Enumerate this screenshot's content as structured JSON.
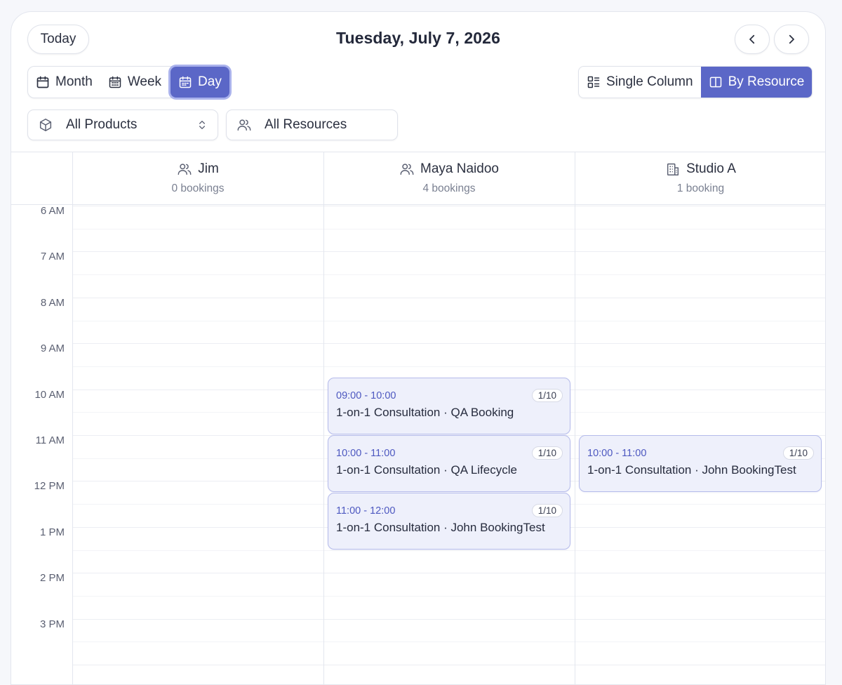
{
  "header": {
    "today_label": "Today",
    "date_title": "Tuesday, July 7, 2026",
    "prev_icon": "chevron-left-icon",
    "next_icon": "chevron-right-icon"
  },
  "views": {
    "month": "Month",
    "week": "Week",
    "day": "Day",
    "active": "Day"
  },
  "layout": {
    "single_column": "Single Column",
    "by_resource": "By Resource",
    "active": "By Resource"
  },
  "filters": {
    "products": "All Products",
    "resources": "All Resources"
  },
  "resources": [
    {
      "name": "Jim",
      "count": "0 bookings",
      "icon": "users-icon"
    },
    {
      "name": "Maya Naidoo",
      "count": "4 bookings",
      "icon": "users-icon"
    },
    {
      "name": "Studio A",
      "count": "1 booking",
      "icon": "building-icon"
    }
  ],
  "time_labels": [
    "6 AM",
    "7 AM",
    "8 AM",
    "9 AM",
    "10 AM",
    "11 AM",
    "12 PM",
    "1 PM",
    "2 PM",
    "3 PM"
  ],
  "events": [
    {
      "resource": "Maya Naidoo",
      "time": "09:00 - 10:00",
      "capacity": "1/10",
      "title": "1-on-1 Consultation · QA Booking"
    },
    {
      "resource": "Maya Naidoo",
      "time": "10:00 - 11:00",
      "capacity": "1/10",
      "title": "1-on-1 Consultation · QA Lifecycle"
    },
    {
      "resource": "Maya Naidoo",
      "time": "11:00 - 12:00",
      "capacity": "1/10",
      "title": "1-on-1 Consultation · John BookingTest"
    },
    {
      "resource": "Studio A",
      "time": "10:00 - 11:00",
      "capacity": "1/10",
      "title": "1-on-1 Consultation · John BookingTest"
    }
  ],
  "colors": {
    "accent": "#5b67c7",
    "accent_ring": "#aab2ec",
    "event_bg": "#eef0fb",
    "event_border": "#b5bbeb",
    "event_time": "#4d58c0"
  }
}
